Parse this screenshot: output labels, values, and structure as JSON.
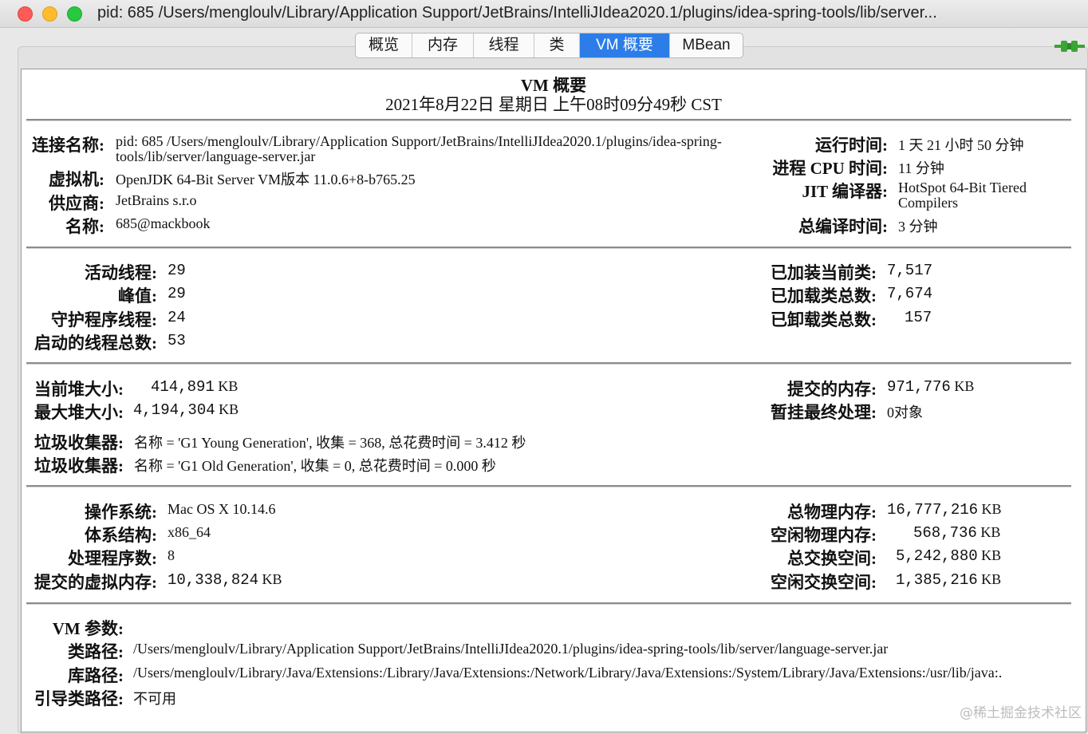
{
  "window": {
    "title": "pid: 685 /Users/mengloulv/Library/Application Support/JetBrains/IntelliJIdea2020.1/plugins/idea-spring-tools/lib/server..."
  },
  "tabs": [
    "概览",
    "内存",
    "线程",
    "类",
    "VM 概要",
    "MBean"
  ],
  "active_tab": "VM 概要",
  "summary": {
    "title": "VM 概要",
    "datetime": "2021年8月22日 星期日 上午08时09分49秒 CST"
  },
  "section1": {
    "connection_label": "连接名称:",
    "connection_value": "pid: 685 /Users/mengloulv/Library/Application Support/JetBrains/IntelliJIdea2020.1/plugins/idea-spring-tools/lib/server/language-server.jar",
    "vm_label": "虚拟机:",
    "vm_value": "OpenJDK 64-Bit Server VM版本 11.0.6+8-b765.25",
    "vendor_label": "供应商:",
    "vendor_value": "JetBrains s.r.o",
    "name_label": "名称:",
    "name_value": "685@mackbook",
    "uptime_label": "运行时间:",
    "uptime_value": "1 天 21 小时 50 分钟",
    "cpu_label": "进程 CPU 时间:",
    "cpu_value": "11 分钟",
    "jit_label": "JIT 编译器:",
    "jit_value": "HotSpot 64-Bit Tiered Compilers",
    "compile_label": "总编译时间:",
    "compile_value": "3 分钟"
  },
  "section2": {
    "live_threads_label": "活动线程:",
    "live_threads_value": "29",
    "peak_label": "峰值:",
    "peak_value": "29",
    "daemon_label": "守护程序线程:",
    "daemon_value": "24",
    "started_label": "启动的线程总数:",
    "started_value": "53",
    "loaded_current_label": "已加装当前类:",
    "loaded_current_value": "7,517",
    "loaded_total_label": "已加载类总数:",
    "loaded_total_value": "7,674",
    "unloaded_label": "已卸载类总数:",
    "unloaded_value": "157"
  },
  "section3": {
    "heap_current_label": "当前堆大小:",
    "heap_current_value": "414,891",
    "heap_max_label": "最大堆大小:",
    "heap_max_value": "4,194,304",
    "committed_label": "提交的内存:",
    "committed_value": "971,776",
    "pending_label": "暂挂最终处理:",
    "pending_value": "0对象",
    "unit_kb": "KB",
    "gc1_label": "垃圾收集器:",
    "gc1_value": "名称 = 'G1 Young Generation', 收集 = 368, 总花费时间 = 3.412 秒",
    "gc2_label": "垃圾收集器:",
    "gc2_value": "名称 = 'G1 Old Generation', 收集 = 0, 总花费时间 = 0.000 秒"
  },
  "section4": {
    "os_label": "操作系统:",
    "os_value": "Mac OS X 10.14.6",
    "arch_label": "体系结构:",
    "arch_value": "x86_64",
    "procs_label": "处理程序数:",
    "procs_value": "8",
    "vmem_label": "提交的虚拟内存:",
    "vmem_value": "10,338,824",
    "phys_total_label": "总物理内存:",
    "phys_total_value": "16,777,216",
    "phys_free_label": "空闲物理内存:",
    "phys_free_value": "568,736",
    "swap_total_label": "总交换空间:",
    "swap_total_value": "5,242,880",
    "swap_free_label": "空闲交换空间:",
    "swap_free_value": "1,385,216",
    "unit_kb": "KB"
  },
  "section5": {
    "vm_args_label": "VM 参数:",
    "classpath_label": "类路径:",
    "classpath_value": "/Users/mengloulv/Library/Application Support/JetBrains/IntelliJIdea2020.1/plugins/idea-spring-tools/lib/server/language-server.jar",
    "libpath_label": "库路径:",
    "libpath_value": "/Users/mengloulv/Library/Java/Extensions:/Library/Java/Extensions:/Network/Library/Java/Extensions:/System/Library/Java/Extensions:/usr/lib/java:.",
    "bootpath_label": "引导类路径:",
    "bootpath_value": "不可用"
  },
  "watermark": "@稀土掘金技术社区",
  "colors": {
    "accent": "#2c7de8",
    "plug": "#3aa535"
  }
}
